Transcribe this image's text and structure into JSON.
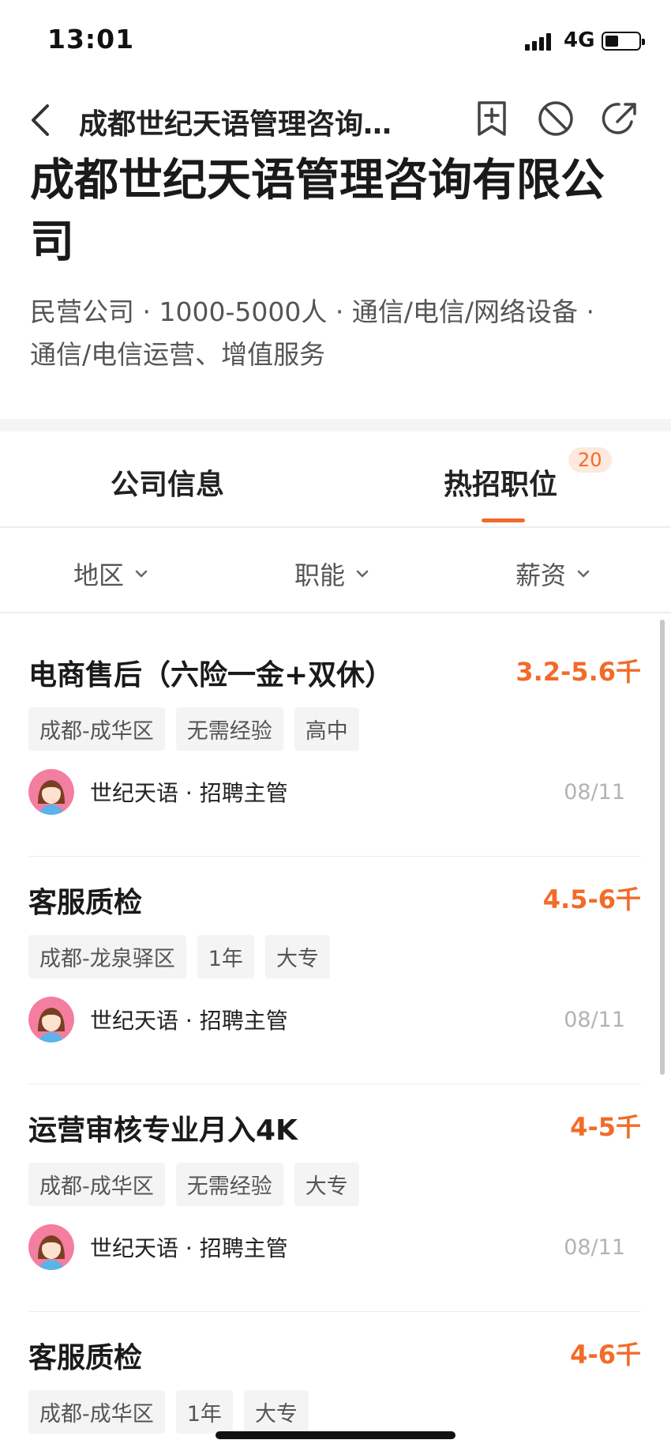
{
  "status_bar": {
    "time": "13:01",
    "network": "4G"
  },
  "nav": {
    "title": "成都世纪天语管理咨询…"
  },
  "company": {
    "name": "成都世纪天语管理咨询有限公司",
    "meta_line1": "民营公司 · 1000-5000人 · 通信/电信/网络设备 ·",
    "meta_line2": "通信/电信运营、增值服务"
  },
  "tabs": [
    {
      "label": "公司信息"
    },
    {
      "label": "热招职位",
      "badge": "20",
      "active": true
    }
  ],
  "filters": [
    {
      "label": "地区"
    },
    {
      "label": "职能"
    },
    {
      "label": "薪资"
    }
  ],
  "jobs": [
    {
      "title": "电商售后（六险一金+双休）",
      "salary": "3.2-5.6千",
      "tags": [
        "成都-成华区",
        "无需经验",
        "高中"
      ],
      "recruiter": "世纪天语 · 招聘主管",
      "date": "08/11"
    },
    {
      "title": "客服质检",
      "salary": "4.5-6千",
      "tags": [
        "成都-龙泉驿区",
        "1年",
        "大专"
      ],
      "recruiter": "世纪天语 · 招聘主管",
      "date": "08/11"
    },
    {
      "title": "运营审核专业月入4K",
      "salary": "4-5千",
      "tags": [
        "成都-成华区",
        "无需经验",
        "大专"
      ],
      "recruiter": "世纪天语 · 招聘主管",
      "date": "08/11"
    },
    {
      "title": "客服质检",
      "salary": "4-6千",
      "tags": [
        "成都-成华区",
        "1年",
        "大专"
      ],
      "recruiter": "",
      "date": ""
    }
  ],
  "colors": {
    "accent": "#f26b29",
    "badge_bg": "#fde9dd",
    "tag_bg": "#f4f4f4"
  }
}
